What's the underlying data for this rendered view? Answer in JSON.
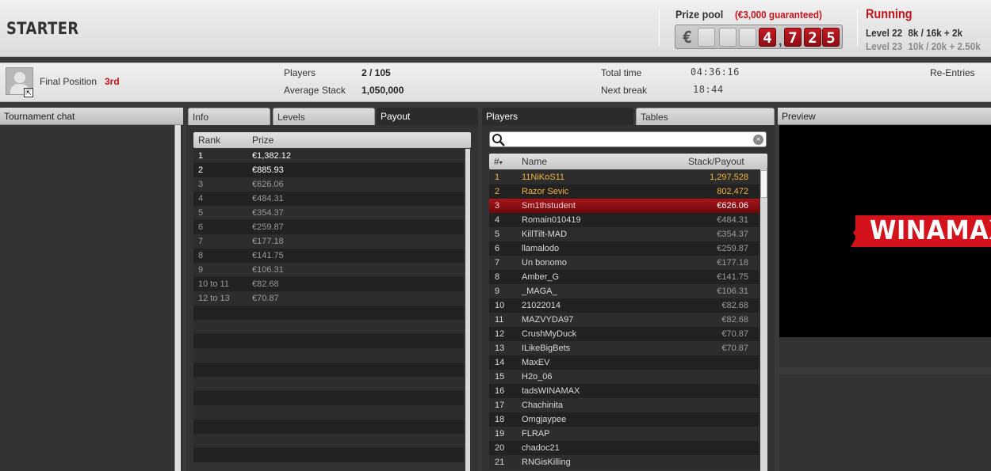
{
  "header": {
    "title": "STARTER",
    "prize_label": "Prize pool",
    "prize_guaranteed": "(€3,000 guaranteed)",
    "prize_currency": "€",
    "prize_digits": [
      "",
      "",
      "",
      "4",
      "7",
      "2",
      "5"
    ],
    "prize_amount": "4,725",
    "status": "Running",
    "level_current_name": "Level 22",
    "level_current_blinds": "8k / 16k + 2k",
    "level_next_name": "Level 23",
    "level_next_blinds": "10k / 20k + 2.50k"
  },
  "infobar": {
    "final_position_label": "Final Position",
    "final_position_value": "3rd",
    "players_label": "Players",
    "players_value": "2 / 105",
    "avg_stack_label": "Average Stack",
    "avg_stack_value": "1,050,000",
    "total_time_label": "Total time",
    "total_time_value": "04:36:16",
    "next_break_label": "Next break",
    "next_break_value": "18:44",
    "reentries_label": "Re-Entries"
  },
  "chat": {
    "header": "Tournament chat"
  },
  "left_tabs": [
    {
      "label": "Info",
      "active": false
    },
    {
      "label": "Levels",
      "active": false
    },
    {
      "label": "Payout",
      "active": true
    }
  ],
  "payout": {
    "col_rank": "Rank",
    "col_prize": "Prize",
    "rows": [
      {
        "rank": "1",
        "prize": "€1,382.12"
      },
      {
        "rank": "2",
        "prize": "€885.93"
      },
      {
        "rank": "3",
        "prize": "€626.06"
      },
      {
        "rank": "4",
        "prize": "€484.31"
      },
      {
        "rank": "5",
        "prize": "€354.37"
      },
      {
        "rank": "6",
        "prize": "€259.87"
      },
      {
        "rank": "7",
        "prize": "€177.18"
      },
      {
        "rank": "8",
        "prize": "€141.75"
      },
      {
        "rank": "9",
        "prize": "€106.31"
      },
      {
        "rank": "10 to 11",
        "prize": "€82.68"
      },
      {
        "rank": "12 to 13",
        "prize": "€70.87"
      }
    ]
  },
  "right_tabs": [
    {
      "label": "Players",
      "active": true
    },
    {
      "label": "Tables",
      "active": false
    }
  ],
  "players": {
    "search_placeholder": "",
    "col_num": "#",
    "col_name": "Name",
    "col_stack": "Stack/Payout",
    "rows": [
      {
        "num": "1",
        "name": "11NiKoS11",
        "stack": "1,297,528"
      },
      {
        "num": "2",
        "name": "Razor Sevic",
        "stack": "802,472"
      },
      {
        "num": "3",
        "name": "Sm1thstudent",
        "stack": "€626.06"
      },
      {
        "num": "4",
        "name": "Romain010419",
        "stack": "€484.31"
      },
      {
        "num": "5",
        "name": "KillTilt-MAD",
        "stack": "€354.37"
      },
      {
        "num": "6",
        "name": "llamalodo",
        "stack": "€259.87"
      },
      {
        "num": "7",
        "name": "Un bonomo",
        "stack": "€177.18"
      },
      {
        "num": "8",
        "name": "Amber_G",
        "stack": "€141.75"
      },
      {
        "num": "9",
        "name": "_MAGA_",
        "stack": "€106.31"
      },
      {
        "num": "10",
        "name": "21022014",
        "stack": "€82.68"
      },
      {
        "num": "11",
        "name": "MAZVYDA97",
        "stack": "€82.68"
      },
      {
        "num": "12",
        "name": "CrushMyDuck",
        "stack": "€70.87"
      },
      {
        "num": "13",
        "name": "ILikeBigBets",
        "stack": "€70.87"
      },
      {
        "num": "14",
        "name": "MaxEV",
        "stack": ""
      },
      {
        "num": "15",
        "name": "H2o_06",
        "stack": ""
      },
      {
        "num": "16",
        "name": "tadsWINAMAX",
        "stack": ""
      },
      {
        "num": "17",
        "name": "Chachinita",
        "stack": ""
      },
      {
        "num": "18",
        "name": "Omgjaypee",
        "stack": ""
      },
      {
        "num": "19",
        "name": "FLRAP",
        "stack": ""
      },
      {
        "num": "20",
        "name": "chadoc21",
        "stack": ""
      },
      {
        "num": "21",
        "name": "RNGisKilling",
        "stack": ""
      }
    ]
  },
  "preview": {
    "header": "Preview",
    "logo_text": "WINAMAX"
  },
  "colors": {
    "accent_red": "#c4141a",
    "gold": "#f2b33d",
    "panel_dark": "#2b2b2b"
  }
}
